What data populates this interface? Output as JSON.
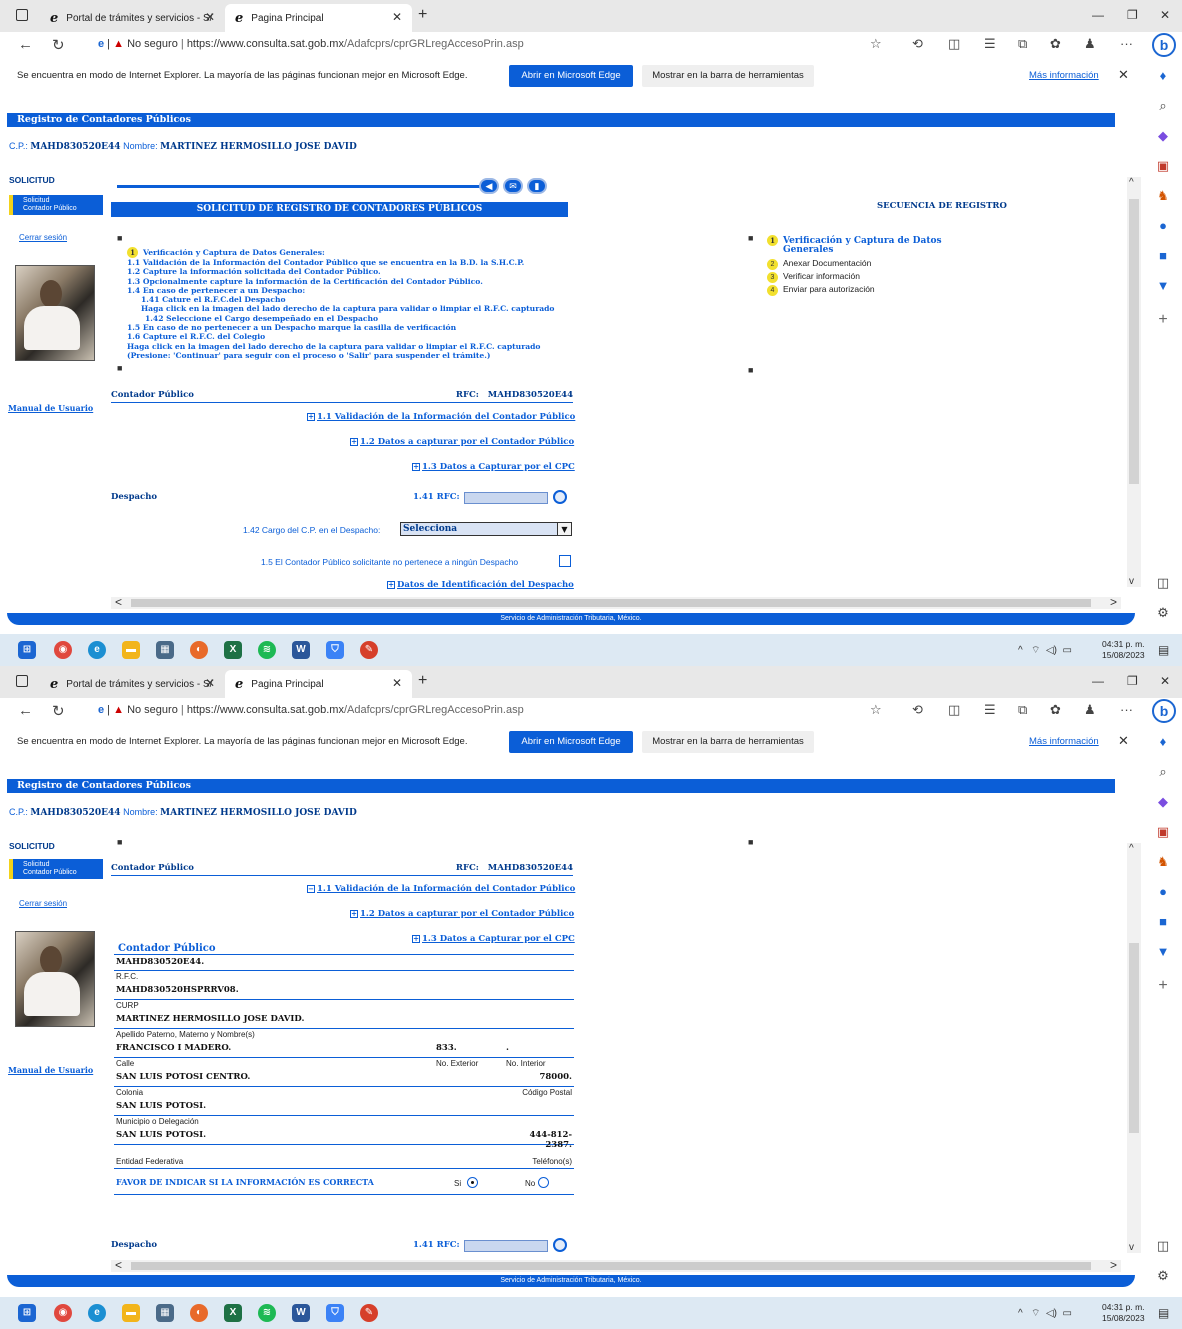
{
  "browser": {
    "tab1": "Portal de trámites y servicios - S/",
    "tab2": "Pagina Principal",
    "not_secure": "No seguro",
    "url_domain": "https://www.consulta.sat.gob.mx",
    "url_path": "/Adafcprs/cprGRLregAccesoPrin.asp",
    "ie_message": "Se encuentra en modo de Internet Explorer. La mayoría de las páginas funcionan mejor en Microsoft Edge.",
    "open_edge": "Abrir en Microsoft Edge",
    "show_toolbar": "Mostrar en la barra de herramientas",
    "more_info": "Más información"
  },
  "page": {
    "title": "Registro de Contadores Públicos",
    "cp_label": "C.P.:",
    "cp_value": "MAHD830520E44",
    "name_label": "Nombre:",
    "name_value": "MARTINEZ HERMOSILLO JOSE DAVID",
    "section": "SOLICITUD",
    "nav_item_line1": "Solicitud",
    "nav_item_line2": "Contador Público",
    "logout": "Cerrar sesión",
    "manual": "Manual de Usuario",
    "header": "SOLICITUD DE REGISTRO DE CONTADORES PÚBLICOS",
    "sequence_title": "SECUENCIA DE REGISTRO",
    "steps": [
      {
        "num": "1",
        "text": "Verificación y Captura de Datos"
      },
      {
        "num": "",
        "text": "Generales"
      },
      {
        "num": "2",
        "text": "Anexar Documentación"
      },
      {
        "num": "3",
        "text": "Verificar información"
      },
      {
        "num": "4",
        "text": "Enviar para autorización"
      }
    ],
    "instructions": [
      "Verificación y Captura de Datos Generales:",
      "1.1 Validación de la Información del Contador Público que se encuentra en la B.D. la S.H.C.P.",
      "1.2 Capture la información solicitada del Contador Público.",
      "1.3 Opcionalmente capture la información de la Certificación del Contador Público.",
      "1.4 En caso de pertenecer a un Despacho:",
      "1.41 Cature el R.F.C.del Despacho",
      "Haga click en la imagen del lado derecho de la captura para validar o limpiar el R.F.C. capturado",
      "1.42 Seleccione el Cargo desempeñado en el Despacho",
      "1.5 En caso de no pertenecer a un Despacho marque la casilla de verificación",
      "1.6 Capture el R.F.C. del Colegio",
      "Haga click en la imagen del lado derecho de la captura para validar o limpiar el R.F.C. capturado",
      "(Presione: 'Continuar' para seguir con el proceso o 'Salir' para suspender el trámite.)"
    ],
    "cp_section": "Contador Público",
    "rfc_label": "RFC:",
    "rfc_value": "MAHD830520E44",
    "link_11": "1.1 Validación de la Información del Contador Público",
    "link_12": "1.2 Datos a capturar por el Contador Público",
    "link_13": "1.3 Datos a Capturar por el CPC",
    "despacho": "Despacho",
    "rfc_141": "1.41 RFC:",
    "cargo_label": "1.42 Cargo del C.P. en el Despacho:",
    "cargo_value": "Selecciona",
    "no_despacho": "1.5 El Contador Público solicitante no pertenece a ningún Despacho",
    "link_despacho": "Datos de Identificación del Despacho",
    "footer": "Servicio de Administración Tributaria, México."
  },
  "form": {
    "title": "Contador Público",
    "rows": [
      {
        "value": "MAHD830520E44.",
        "label": ""
      },
      {
        "value": "MAHD830520HSPRRV08.",
        "label": "R.F.C."
      },
      {
        "value": "MARTINEZ HERMOSILLO JOSE DAVID.",
        "label": "CURP"
      },
      {
        "value": "",
        "label": "Apellido Paterno, Materno y Nombre(s)"
      }
    ],
    "street": "FRANCISCO I MADERO.",
    "ext_num": "833.",
    "int_num": ".",
    "street_label": "Calle",
    "ext_label": "No. Exterior",
    "int_label": "No. Interior",
    "colony": "SAN LUIS POTOSI CENTRO.",
    "zip": "78000.",
    "colony_label": "Colonia",
    "zip_label": "Código Postal",
    "municipality": "SAN LUIS POTOSI.",
    "municipality_label": "Municipio o Delegación",
    "state": "SAN LUIS POTOSI.",
    "phone_line1": "444-812-",
    "phone_line2": "2387.",
    "state_label": "Entidad Federativa",
    "phone_label": "Teléfono(s)",
    "confirm": "FAVOR DE INDICAR SI LA INFORMACIÓN ES CORRECTA",
    "yes": "Si",
    "no": "No"
  },
  "taskbar": {
    "time": "04:31 p. m.",
    "date": "15/08/2023"
  },
  "colors": {
    "brand_blue": "#0b5ed7",
    "highlight_yellow": "#f2e02e"
  }
}
